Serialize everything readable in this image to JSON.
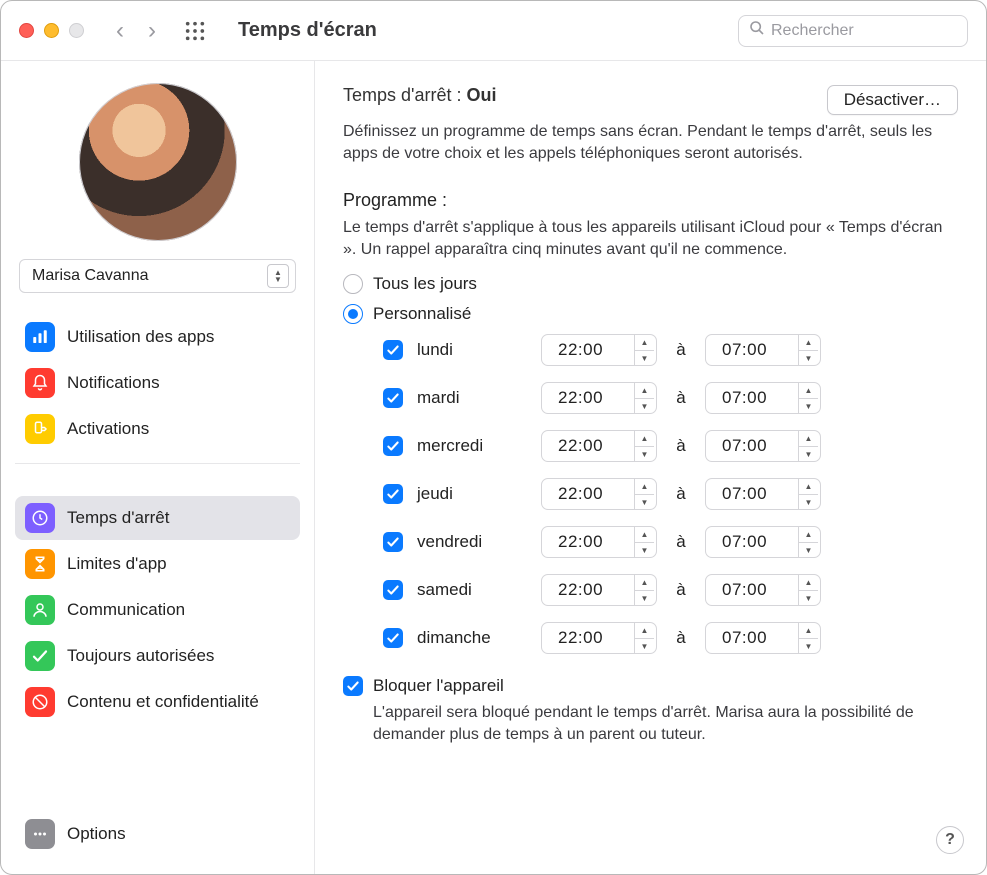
{
  "window": {
    "title": "Temps d'écran",
    "search_placeholder": "Rechercher"
  },
  "user": {
    "name": "Marisa Cavanna"
  },
  "sidebar": {
    "group1": [
      {
        "key": "usage",
        "label": "Utilisation des apps",
        "color": "#0a7aff",
        "icon": "bars"
      },
      {
        "key": "notifications",
        "label": "Notifications",
        "color": "#ff3b30",
        "icon": "bell"
      },
      {
        "key": "activations",
        "label": "Activations",
        "color": "#ffcc00",
        "icon": "pickup"
      }
    ],
    "group2": [
      {
        "key": "downtime",
        "label": "Temps d'arrêt",
        "color": "#7d5fff",
        "icon": "clock",
        "selected": true
      },
      {
        "key": "applimits",
        "label": "Limites d'app",
        "color": "#ff9500",
        "icon": "hourglass"
      },
      {
        "key": "communication",
        "label": "Communication",
        "color": "#34c759",
        "icon": "person"
      },
      {
        "key": "allowed",
        "label": "Toujours autorisées",
        "color": "#34c759",
        "icon": "check"
      },
      {
        "key": "content",
        "label": "Contenu et confidentialité",
        "color": "#ff3b30",
        "icon": "nosign"
      }
    ],
    "footer": {
      "label": "Options",
      "color": "#8e8e93",
      "icon": "dots"
    }
  },
  "content": {
    "status_label": "Temps d'arrêt :",
    "status_value": "Oui",
    "deactivate": "Désactiver…",
    "status_desc": "Définissez un programme de temps sans écran. Pendant le temps d'arrêt, seuls les apps de votre choix et les appels téléphoniques seront autorisés.",
    "program_h": "Programme :",
    "program_desc": "Le temps d'arrêt s'applique à tous les appareils utilisant iCloud pour « Temps d'écran ». Un rappel apparaîtra cinq minutes avant qu'il ne commence.",
    "radio_everyday": "Tous les jours",
    "radio_custom": "Personnalisé",
    "to_word": "à",
    "days": [
      {
        "name": "lundi",
        "enabled": true,
        "from": "22:00",
        "to": "07:00"
      },
      {
        "name": "mardi",
        "enabled": true,
        "from": "22:00",
        "to": "07:00"
      },
      {
        "name": "mercredi",
        "enabled": true,
        "from": "22:00",
        "to": "07:00"
      },
      {
        "name": "jeudi",
        "enabled": true,
        "from": "22:00",
        "to": "07:00"
      },
      {
        "name": "vendredi",
        "enabled": true,
        "from": "22:00",
        "to": "07:00"
      },
      {
        "name": "samedi",
        "enabled": true,
        "from": "22:00",
        "to": "07:00"
      },
      {
        "name": "dimanche",
        "enabled": true,
        "from": "22:00",
        "to": "07:00"
      }
    ],
    "block_label": "Bloquer l'appareil",
    "block_desc": "L'appareil sera bloqué pendant le temps d'arrêt. Marisa aura la possibilité de demander plus de temps à un parent ou tuteur."
  }
}
